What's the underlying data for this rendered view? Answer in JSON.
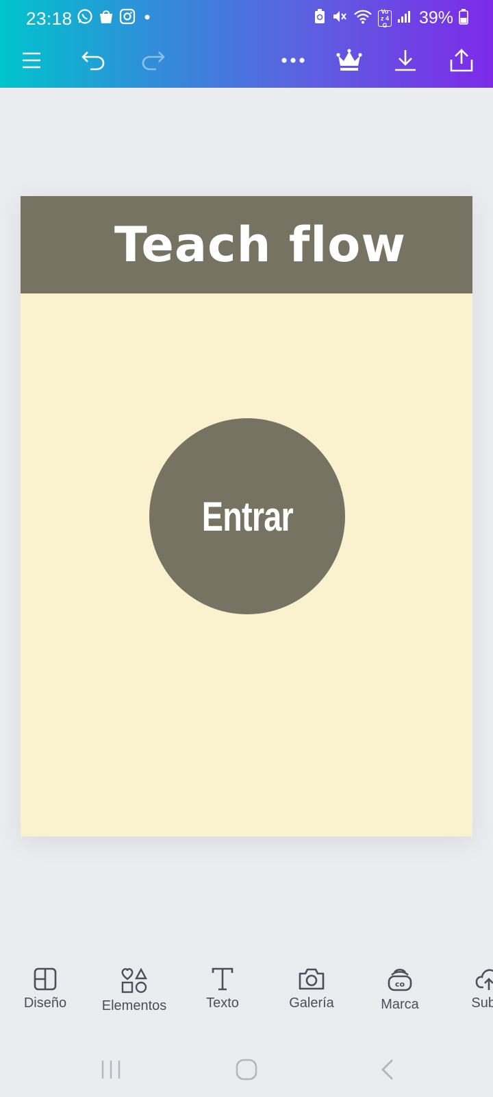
{
  "status_bar": {
    "time": "23:18",
    "network_label": "Voz 4G",
    "battery": "39%",
    "left_icons": [
      "whatsapp-icon",
      "shopping-bag-icon",
      "instagram-icon",
      "dot-icon"
    ],
    "right_icons": [
      "battery-saver-icon",
      "mute-icon",
      "wifi-icon",
      "volte-icon",
      "signal-icon",
      "battery-icon"
    ]
  },
  "toolbar": {
    "icons": [
      "menu-icon",
      "undo-icon",
      "redo-icon",
      "more-icon",
      "crown-icon",
      "download-icon",
      "share-icon"
    ]
  },
  "design": {
    "title": "Teach flow",
    "button_label": "Entrar",
    "colors": {
      "band": "#777362",
      "page": "#faf2cf",
      "text": "#ffffff"
    }
  },
  "bottom_tools": [
    {
      "label": "Diseño",
      "icon": "layout-icon"
    },
    {
      "label": "Elementos",
      "icon": "shapes-icon"
    },
    {
      "label": "Texto",
      "icon": "text-icon"
    },
    {
      "label": "Galería",
      "icon": "camera-icon"
    },
    {
      "label": "Marca",
      "icon": "brand-icon"
    },
    {
      "label": "Subie",
      "icon": "upload-cloud-icon"
    }
  ],
  "nav_bar": {
    "icons": [
      "recent-apps-icon",
      "home-icon",
      "back-icon"
    ]
  },
  "theme": {
    "gradient_start": "#00c4cc",
    "gradient_end": "#7d2ae8",
    "background": "#ebecef"
  }
}
